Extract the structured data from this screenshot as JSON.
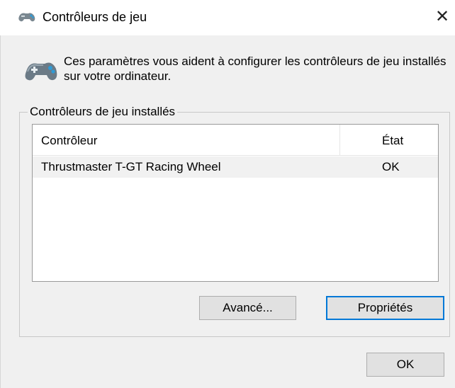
{
  "window": {
    "title": "Contrôleurs de jeu",
    "close_glyph": "✕",
    "title_icon": "gamepad-icon"
  },
  "intro": {
    "icon": "gamepad-icon",
    "text": "Ces paramètres vous aident à configurer les contrôleurs de jeu installés sur votre ordinateur."
  },
  "group": {
    "label": "Contrôleurs de jeu installés"
  },
  "list": {
    "columns": [
      "Contrôleur",
      "État"
    ],
    "rows": [
      {
        "controller": "Thrustmaster T-GT Racing Wheel",
        "state": "OK",
        "selected": true
      }
    ]
  },
  "buttons": {
    "advanced": "Avancé...",
    "properties": "Propriétés",
    "ok": "OK"
  },
  "colors": {
    "focus_border": "#0078d7",
    "dialog_bg": "#f0f0f0"
  }
}
